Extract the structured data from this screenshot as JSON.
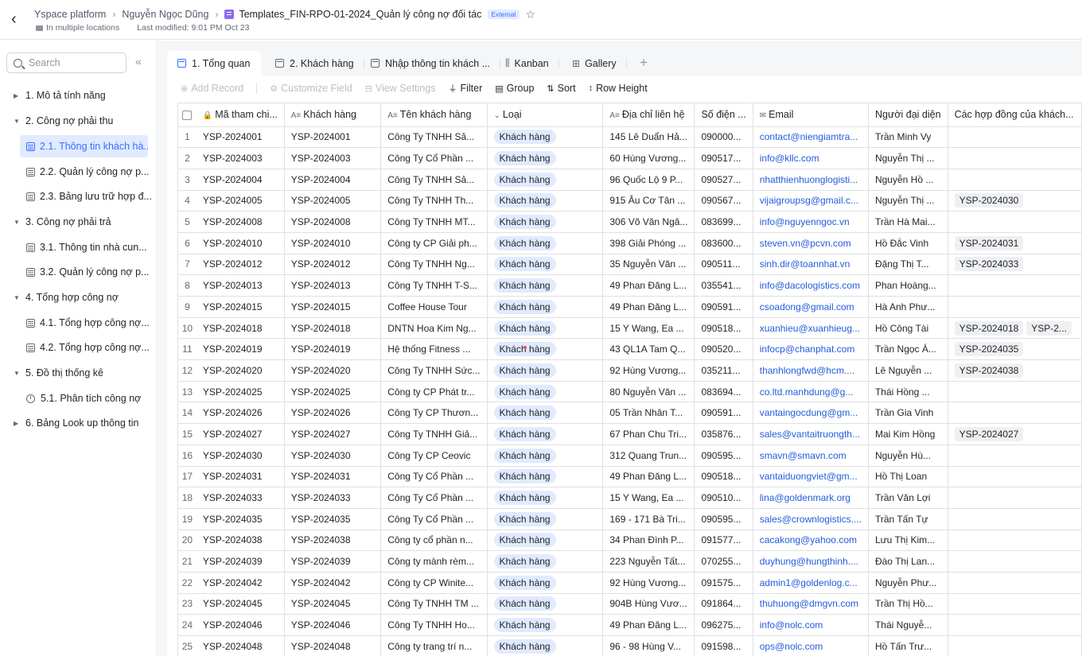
{
  "header": {
    "platform": "Yspace platform",
    "owner": "Nguyễn Ngọc Dũng",
    "doc_title": "Templates_FIN-RPO-01-2024_Quản lý công nợ đối tác",
    "badge": "External",
    "location": "In multiple locations",
    "modified": "Last modified: 9:01 PM Oct 23"
  },
  "sidebar": {
    "search_placeholder": "Search",
    "items": [
      {
        "label": "1. Mô tả tính năng"
      },
      {
        "label": "2. Công nợ phải thu"
      },
      {
        "label": "2.1. Thông tin khách hà..."
      },
      {
        "label": "2.2. Quản lý công nợ p..."
      },
      {
        "label": "2.3. Bảng lưu trữ hợp đ..."
      },
      {
        "label": "3. Công nợ phải trả"
      },
      {
        "label": "3.1. Thông tin nhà cun..."
      },
      {
        "label": "3.2. Quản lý công nợ p..."
      },
      {
        "label": "4. Tổng hợp công nợ"
      },
      {
        "label": "4.1. Tổng hợp công nợ..."
      },
      {
        "label": "4.2. Tổng hợp công nợ..."
      },
      {
        "label": "5. Đồ thị thống kê"
      },
      {
        "label": "5.1. Phân tích công nợ"
      },
      {
        "label": "6. Bảng Look up thông tin"
      }
    ]
  },
  "tabs": [
    {
      "label": "1. Tổng quan"
    },
    {
      "label": "2. Khách hàng"
    },
    {
      "label": "Nhập thông tin khách ..."
    },
    {
      "label": "Kanban"
    },
    {
      "label": "Gallery"
    }
  ],
  "toolbar": {
    "add_record": "Add Record",
    "customize_field": "Customize Field",
    "view_settings": "View Settings",
    "filter": "Filter",
    "group": "Group",
    "sort": "Sort",
    "row_height": "Row Height"
  },
  "columns": [
    "Mã tham chi...",
    "Khách hàng",
    "Tên khách hàng",
    "Loại",
    "Địa chỉ liên hệ",
    "Số điện ...",
    "Email",
    "Người đại diện",
    "Các hợp đồng của khách..."
  ],
  "rows": [
    {
      "n": "1",
      "ma": "YSP-2024001",
      "kh": "YSP-2024001",
      "ten": "Công Ty TNHH Sả...",
      "loai": "Khách hàng",
      "dc": "145 Lê Duẩn Hả...",
      "sdt": "090000...",
      "email": "contact@niengiamtra...",
      "nguoi": "Trần Minh Vy",
      "hd": []
    },
    {
      "n": "2",
      "ma": "YSP-2024003",
      "kh": "YSP-2024003",
      "ten": "Công Ty Cổ Phần ...",
      "loai": "Khách hàng",
      "dc": "60 Hùng Vương...",
      "sdt": "090517...",
      "email": "info@kllc.com",
      "nguoi": "Nguyễn Thị ...",
      "hd": []
    },
    {
      "n": "3",
      "ma": "YSP-2024004",
      "kh": "YSP-2024004",
      "ten": "Công Ty TNHH Sả...",
      "loai": "Khách hàng",
      "dc": "96 Quốc Lộ 9 P...",
      "sdt": "090527...",
      "email": "nhatthienhuonglogisti...",
      "nguoi": "Nguyễn Hồ ...",
      "hd": []
    },
    {
      "n": "4",
      "ma": "YSP-2024005",
      "kh": "YSP-2024005",
      "ten": "Công Ty TNHH Th...",
      "loai": "Khách hàng",
      "dc": "915 Âu Cơ Tân ...",
      "sdt": "090567...",
      "email": "vijaigroupsg@gmail.c...",
      "nguoi": "Nguyễn Thị ...",
      "hd": [
        "YSP-2024030"
      ]
    },
    {
      "n": "5",
      "ma": "YSP-2024008",
      "kh": "YSP-2024008",
      "ten": "Công Ty TNHH MT...",
      "loai": "Khách hàng",
      "dc": "306 Võ Văn Ngâ...",
      "sdt": "083699...",
      "email": "info@nguyenngoc.vn",
      "nguoi": "Trần Hà Mai...",
      "hd": []
    },
    {
      "n": "6",
      "ma": "YSP-2024010",
      "kh": "YSP-2024010",
      "ten": "Công ty CP Giải ph...",
      "loai": "Khách hàng",
      "dc": "398 Giải Phóng ...",
      "sdt": "083600...",
      "email": "steven.vn@pcvn.com",
      "nguoi": "Hồ Đắc Vinh",
      "hd": [
        "YSP-2024031"
      ]
    },
    {
      "n": "7",
      "ma": "YSP-2024012",
      "kh": "YSP-2024012",
      "ten": "Công Ty TNHH Ng...",
      "loai": "Khách hàng",
      "dc": "35 Nguyễn Văn ...",
      "sdt": "090511...",
      "email": "sinh.dir@toannhat.vn",
      "nguoi": "Đặng Thị T...",
      "hd": [
        "YSP-2024033"
      ]
    },
    {
      "n": "8",
      "ma": "YSP-2024013",
      "kh": "YSP-2024013",
      "ten": "Công Ty TNHH T-S...",
      "loai": "Khách hàng",
      "dc": "49 Phan Đăng L...",
      "sdt": "035541...",
      "email": "info@dacologistics.com",
      "nguoi": "Phan Hoàng...",
      "hd": []
    },
    {
      "n": "9",
      "ma": "YSP-2024015",
      "kh": "YSP-2024015",
      "ten": "Coffee House Tour",
      "loai": "Khách hàng",
      "dc": "49 Phan Đăng L...",
      "sdt": "090591...",
      "email": "csoadong@gmail.com",
      "nguoi": "Hà Anh Phư...",
      "hd": []
    },
    {
      "n": "10",
      "ma": "YSP-2024018",
      "kh": "YSP-2024018",
      "ten": "DNTN Hoa Kim Ng...",
      "loai": "Khách hàng",
      "dc": "15 Y Wang, Ea ...",
      "sdt": "090518...",
      "email": "xuanhieu@xuanhieug...",
      "nguoi": "Hồ Công Tài",
      "hd": [
        "YSP-2024018",
        "YSP-2..."
      ]
    },
    {
      "n": "11",
      "ma": "YSP-2024019",
      "kh": "YSP-2024019",
      "ten": "Hệ thống Fitness ...",
      "loai": "Khách hàng",
      "dc": "43 QL1A Tam Q...",
      "sdt": "090520...",
      "email": "infocp@chanphat.com",
      "nguoi": "Trần Ngọc Á...",
      "hd": [
        "YSP-2024035"
      ]
    },
    {
      "n": "12",
      "ma": "YSP-2024020",
      "kh": "YSP-2024020",
      "ten": "Công Ty TNHH Sức...",
      "loai": "Khách hàng",
      "dc": "92 Hùng Vương...",
      "sdt": "035211...",
      "email": "thanhlongfwd@hcm....",
      "nguoi": "Lê Nguyễn ...",
      "hd": [
        "YSP-2024038"
      ]
    },
    {
      "n": "13",
      "ma": "YSP-2024025",
      "kh": "YSP-2024025",
      "ten": "Công ty CP Phát tr...",
      "loai": "Khách hàng",
      "dc": "80 Nguyễn Văn ...",
      "sdt": "083694...",
      "email": "co.ltd.manhdung@g...",
      "nguoi": "Thái Hồng ...",
      "hd": []
    },
    {
      "n": "14",
      "ma": "YSP-2024026",
      "kh": "YSP-2024026",
      "ten": "Công Ty CP Thươn...",
      "loai": "Khách hàng",
      "dc": "05 Trần Nhân T...",
      "sdt": "090591...",
      "email": "vantaingocdung@gm...",
      "nguoi": "Trần Gia Vinh",
      "hd": []
    },
    {
      "n": "15",
      "ma": "YSP-2024027",
      "kh": "YSP-2024027",
      "ten": "Công Ty TNHH Giả...",
      "loai": "Khách hàng",
      "dc": "67 Phan Chu Tri...",
      "sdt": "035876...",
      "email": "sales@vantaitruongth...",
      "nguoi": "Mai Kim Hồng",
      "hd": [
        "YSP-2024027"
      ]
    },
    {
      "n": "16",
      "ma": "YSP-2024030",
      "kh": "YSP-2024030",
      "ten": "Công Ty CP Ceovic",
      "loai": "Khách hàng",
      "dc": "312 Quang Trun...",
      "sdt": "090595...",
      "email": "smavn@smavn.com",
      "nguoi": "Nguyễn Hù...",
      "hd": []
    },
    {
      "n": "17",
      "ma": "YSP-2024031",
      "kh": "YSP-2024031",
      "ten": "Công Ty Cổ Phần ...",
      "loai": "Khách hàng",
      "dc": "49 Phan Đăng L...",
      "sdt": "090518...",
      "email": "vantaiduongviet@gm...",
      "nguoi": "Hồ Thị Loan",
      "hd": []
    },
    {
      "n": "18",
      "ma": "YSP-2024033",
      "kh": "YSP-2024033",
      "ten": "Công Ty Cổ Phần ...",
      "loai": "Khách hàng",
      "dc": "15 Y Wang, Ea ...",
      "sdt": "090510...",
      "email": "lina@goldenmark.org",
      "nguoi": "Trần Văn Lợi",
      "hd": []
    },
    {
      "n": "19",
      "ma": "YSP-2024035",
      "kh": "YSP-2024035",
      "ten": "Công Ty Cổ Phần ...",
      "loai": "Khách hàng",
      "dc": "169 - 171 Bà Tri...",
      "sdt": "090595...",
      "email": "sales@crownlogistics....",
      "nguoi": "Trần Tấn Tự",
      "hd": []
    },
    {
      "n": "20",
      "ma": "YSP-2024038",
      "kh": "YSP-2024038",
      "ten": "Công ty cổ phần n...",
      "loai": "Khách hàng",
      "dc": "34 Phan Đình P...",
      "sdt": "091577...",
      "email": "cacakong@yahoo.com",
      "nguoi": "Lưu Thị Kim...",
      "hd": []
    },
    {
      "n": "21",
      "ma": "YSP-2024039",
      "kh": "YSP-2024039",
      "ten": "Công ty mành rèm...",
      "loai": "Khách hàng",
      "dc": "223 Nguyễn Tất...",
      "sdt": "070255...",
      "email": "duyhung@hungthinh....",
      "nguoi": "Đào Thị Lan...",
      "hd": []
    },
    {
      "n": "22",
      "ma": "YSP-2024042",
      "kh": "YSP-2024042",
      "ten": "Công ty CP Winite...",
      "loai": "Khách hàng",
      "dc": "92 Hùng Vương...",
      "sdt": "091575...",
      "email": "admin1@goldenlog.c...",
      "nguoi": "Nguyễn Phư...",
      "hd": []
    },
    {
      "n": "23",
      "ma": "YSP-2024045",
      "kh": "YSP-2024045",
      "ten": "Công Ty TNHH TM ...",
      "loai": "Khách hàng",
      "dc": "904B Hùng Vươ...",
      "sdt": "091864...",
      "email": "thuhuong@dmgvn.com",
      "nguoi": "Trần Thị Hồ...",
      "hd": []
    },
    {
      "n": "24",
      "ma": "YSP-2024046",
      "kh": "YSP-2024046",
      "ten": "Công Ty TNHH Ho...",
      "loai": "Khách hàng",
      "dc": "49 Phan Đăng L...",
      "sdt": "096275...",
      "email": "info@nolc.com",
      "nguoi": "Thái Nguyễ...",
      "hd": []
    },
    {
      "n": "25",
      "ma": "YSP-2024048",
      "kh": "YSP-2024048",
      "ten": "Công ty trang trí n...",
      "loai": "Khách hàng",
      "dc": "96 - 98 Hùng V...",
      "sdt": "091598...",
      "email": "ops@nolc.com",
      "nguoi": "Hồ Tấn Trư...",
      "hd": []
    }
  ]
}
